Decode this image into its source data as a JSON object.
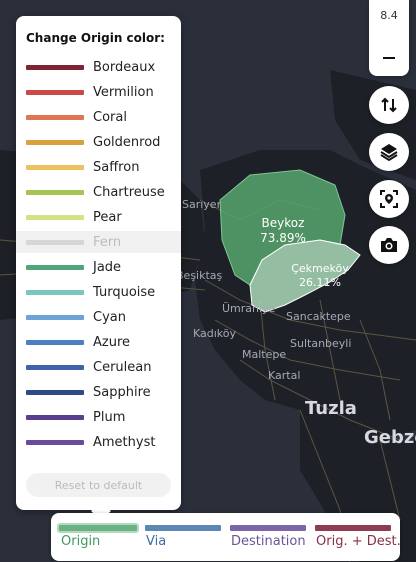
{
  "colors": {
    "map_bg": "#2a2f3a",
    "land": "#1d2026",
    "road": "#5c5543",
    "water_label": "#a4aab5",
    "origin_green": "#57a66d"
  },
  "map": {
    "places": [
      {
        "name": "Sarıyer"
      },
      {
        "name": "Beşiktaş"
      },
      {
        "name": "Ümraniye"
      },
      {
        "name": "Kadıköy"
      },
      {
        "name": "Maltepe"
      },
      {
        "name": "Sancaktepe"
      },
      {
        "name": "Sultanbeyli"
      },
      {
        "name": "Kartal"
      },
      {
        "name": "Tuzla"
      },
      {
        "name": "Gebze"
      }
    ],
    "regions": [
      {
        "name": "Beykoz",
        "percent": "73.89%"
      },
      {
        "name": "Çekmeköy",
        "percent": "26.11%"
      }
    ]
  },
  "color_panel": {
    "title": "Change Origin color:",
    "options": [
      {
        "label": "Bordeaux",
        "color": "#7d2537",
        "disabled": false
      },
      {
        "label": "Vermilion",
        "color": "#c84b48",
        "disabled": false
      },
      {
        "label": "Coral",
        "color": "#e07455",
        "disabled": false
      },
      {
        "label": "Goldenrod",
        "color": "#d7a23e",
        "disabled": false
      },
      {
        "label": "Saffron",
        "color": "#ebc25f",
        "disabled": false
      },
      {
        "label": "Chartreuse",
        "color": "#a6c455",
        "disabled": false
      },
      {
        "label": "Pear",
        "color": "#d3e283",
        "disabled": false
      },
      {
        "label": "Fern",
        "color": "#d6d6d6",
        "disabled": true
      },
      {
        "label": "Jade",
        "color": "#52a47a",
        "disabled": false
      },
      {
        "label": "Turquoise",
        "color": "#7cc6bf",
        "disabled": false
      },
      {
        "label": "Cyan",
        "color": "#6ba3d6",
        "disabled": false
      },
      {
        "label": "Azure",
        "color": "#4e7fc0",
        "disabled": false
      },
      {
        "label": "Cerulean",
        "color": "#3f63a6",
        "disabled": false
      },
      {
        "label": "Sapphire",
        "color": "#2f4b86",
        "disabled": false
      },
      {
        "label": "Plum",
        "color": "#5a3f8f",
        "disabled": false
      },
      {
        "label": "Amethyst",
        "color": "#6a4a9c",
        "disabled": false
      }
    ],
    "reset_label": "Reset to default"
  },
  "toolbar": {
    "zoom_level": "8.4",
    "zoom_out_icon": "minus-icon",
    "buttons": [
      "swap-icon",
      "layers-icon",
      "locate-icon",
      "camera-icon"
    ]
  },
  "legend": {
    "items": [
      {
        "label": "Origin",
        "color": "#6bb283",
        "text_color": "#3e9a62",
        "active": true
      },
      {
        "label": "Via",
        "color": "#5b88b4",
        "text_color": "#3e6e9f",
        "active": false
      },
      {
        "label": "Destination",
        "color": "#7c66a8",
        "text_color": "#6b559a",
        "active": false
      },
      {
        "label": "Orig. + Dest.",
        "color": "#8d3d52",
        "text_color": "#8a2f46",
        "active": false
      }
    ]
  }
}
